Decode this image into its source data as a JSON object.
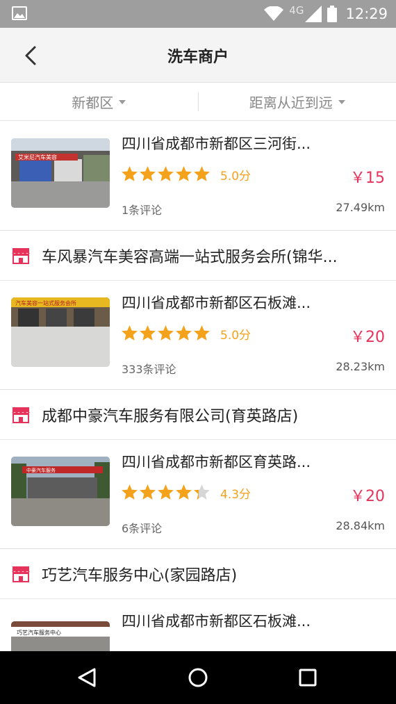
{
  "statusbar": {
    "network": "4G",
    "time": "12:29"
  },
  "header": {
    "title": "洗车商户"
  },
  "filters": {
    "area": "新都区",
    "sort": "距离从近到远"
  },
  "colors": {
    "star": "#f4a21c",
    "price": "#e6335c",
    "shop_icon": "#e6335c"
  },
  "items": [
    {
      "store_name": "",
      "address": "四川省成都市新都区三河街...",
      "rating": 5.0,
      "score_label": "5.0分",
      "price": "￥15",
      "reviews": "1条评论",
      "distance": "27.49km",
      "thumb_sign": "艾米尼汽车美容"
    },
    {
      "store_name": "车风暴汽车美容高端一站式服务会所(锦华...",
      "address": "四川省成都市新都区石板滩...",
      "rating": 5.0,
      "score_label": "5.0分",
      "price": "￥20",
      "reviews": "333条评论",
      "distance": "28.23km",
      "thumb_sign": "汽车美容一站式服务会所"
    },
    {
      "store_name": "成都中豪汽车服务有限公司(育英路店)",
      "address": "四川省成都市新都区育英路...",
      "rating": 4.3,
      "score_label": "4.3分",
      "price": "￥20",
      "reviews": "6条评论",
      "distance": "28.84km",
      "thumb_sign": "中豪汽车服务"
    },
    {
      "store_name": "巧艺汽车服务中心(家园路店)",
      "address": "四川省成都市新都区石板滩...",
      "thumb_sign": "巧艺汽车服务中心"
    }
  ]
}
